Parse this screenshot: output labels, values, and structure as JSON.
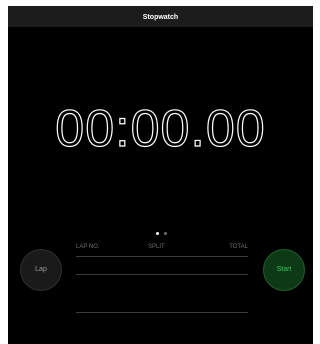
{
  "window": {
    "title": "Stopwatch"
  },
  "timer": {
    "display": "00:00.00"
  },
  "pager": {
    "page_count": 2,
    "active_page": 1
  },
  "buttons": {
    "lap_label": "Lap",
    "start_label": "Start"
  },
  "laps_table": {
    "columns": [
      "LAP NO.",
      "SPLIT",
      "TOTAL"
    ],
    "rows": []
  },
  "colors": {
    "background": "#000000",
    "start_accent": "#34c759",
    "lap_text": "#9a9a9a"
  }
}
